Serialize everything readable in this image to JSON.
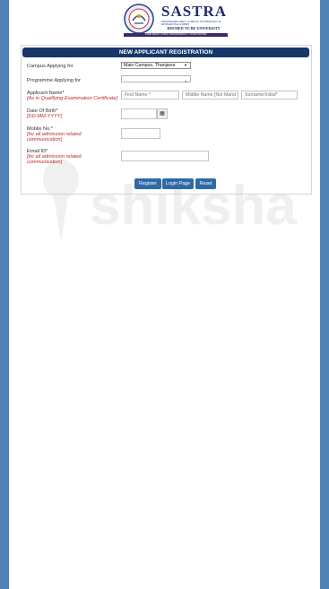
{
  "logo": {
    "name": "SASTRA",
    "sub": "SHANMUGHA ARTS, SCIENCE, TECHNOLOGY & RESEARCH ACADEMY",
    "deemed": "DEEMED TO BE UNIVERSITY",
    "motto": "THINK MERIT | THINK TRANSPARENCY | THINK SASTRA"
  },
  "watermark": {
    "text": "shiksha"
  },
  "form": {
    "title": "NEW APPLICANT REGISTRATION",
    "campus": {
      "label": "Campus Applying for",
      "value": "Main Campus, Thanjavur"
    },
    "programme": {
      "label": "Programme Applying for",
      "value": ""
    },
    "name": {
      "label": "Applicant Name*",
      "note": "[As in Qualifying Examination Certificate]",
      "first_placeholder": "First Name *",
      "middle_placeholder": "Middle Name [Not Mandatory]",
      "last_placeholder": "Surname/Initial*"
    },
    "dob": {
      "label": "Date Of Birth*",
      "note": "[DD-MM-YYYY]",
      "value": ""
    },
    "mobile": {
      "label": "Mobile No.*",
      "note": "[for all admission related communication]",
      "value": ""
    },
    "email": {
      "label": "Email ID*",
      "note": "[for all admission related communication]",
      "value": ""
    },
    "buttons": {
      "register": "Register",
      "login": "Login Page",
      "reset": "Reset"
    }
  }
}
